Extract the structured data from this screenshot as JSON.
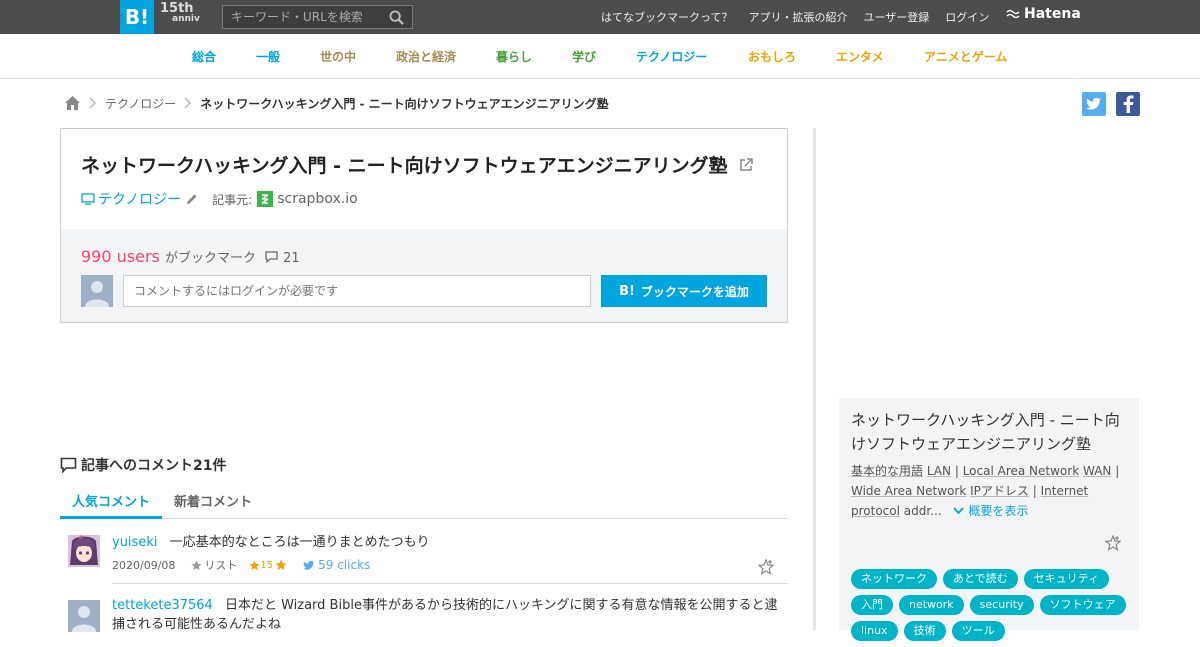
{
  "header": {
    "logo": "B!",
    "anniv_top": "15th",
    "anniv_bottom": "anniv",
    "search_placeholder": "キーワード・URLを検索",
    "links": [
      "はてなブックマークって？",
      "アプリ・拡張の紹介",
      "ユーザー登録",
      "ログイン"
    ],
    "brand": "Hatena"
  },
  "categories": [
    {
      "label": "総合",
      "color": "#00a4de"
    },
    {
      "label": "一般",
      "color": "#00a4de"
    },
    {
      "label": "世の中",
      "color": "#a48b57"
    },
    {
      "label": "政治と経済",
      "color": "#a48b57"
    },
    {
      "label": "暮らし",
      "color": "#4aa03d"
    },
    {
      "label": "学び",
      "color": "#4aa03d"
    },
    {
      "label": "テクノロジー",
      "color": "#00a4de"
    },
    {
      "label": "おもしろ",
      "color": "#f0a300"
    },
    {
      "label": "エンタメ",
      "color": "#f0a300"
    },
    {
      "label": "アニメとゲーム",
      "color": "#f0a300"
    }
  ],
  "breadcrumb": {
    "category": "テクノロジー",
    "current": "ネットワークハッキング入門 - ニート向けソフトウェアエンジニアリング塾"
  },
  "entry": {
    "title": "ネットワークハッキング入門 - ニート向けソフトウェアエンジニアリング塾",
    "category": "テクノロジー",
    "source_label": "記事元:",
    "source": "scrapbox.io",
    "users": "990 users",
    "users_suffix": "がブックマーク",
    "comment_count": "21",
    "comment_placeholder": "コメントするにはログインが必要です",
    "add_button": "ブックマークを追加"
  },
  "comments_section": {
    "title": "記事へのコメント21件",
    "tabs": [
      "人気コメント",
      "新着コメント"
    ],
    "items": [
      {
        "user": "yuiseki",
        "text": "一応基本的なところは一通りまとめたつもり",
        "date": "2020/09/08",
        "list_label": "リスト",
        "stars": "15",
        "clicks": "59 clicks"
      },
      {
        "user": "tettekete37564",
        "text": "日本だと Wizard Bible事件があるから技術的にハッキングに関する有意な情報を公開すると逮捕される可能性あるんだよね"
      }
    ]
  },
  "sidebar": {
    "title": "ネットワークハッキング入門 - ニート向けソフトウェアエンジニアリング塾",
    "desc_parts": [
      "基本的な用語",
      "LAN",
      "|",
      "Local Area Network",
      "WAN",
      "|",
      "Wide Area Network",
      "IPアドレス",
      "|",
      "Internet protocol",
      "addr..."
    ],
    "more": "概要を表示",
    "tags": [
      "ネットワーク",
      "あとで読む",
      "セキュリティ",
      "入門",
      "network",
      "security",
      "ソフトウェア",
      "linux",
      "技術",
      "ツール"
    ]
  },
  "colors": {
    "accent": "#00a4de",
    "users": "#ff4166",
    "tag": "#00b4c8",
    "topbar": "#4d4d4d"
  }
}
